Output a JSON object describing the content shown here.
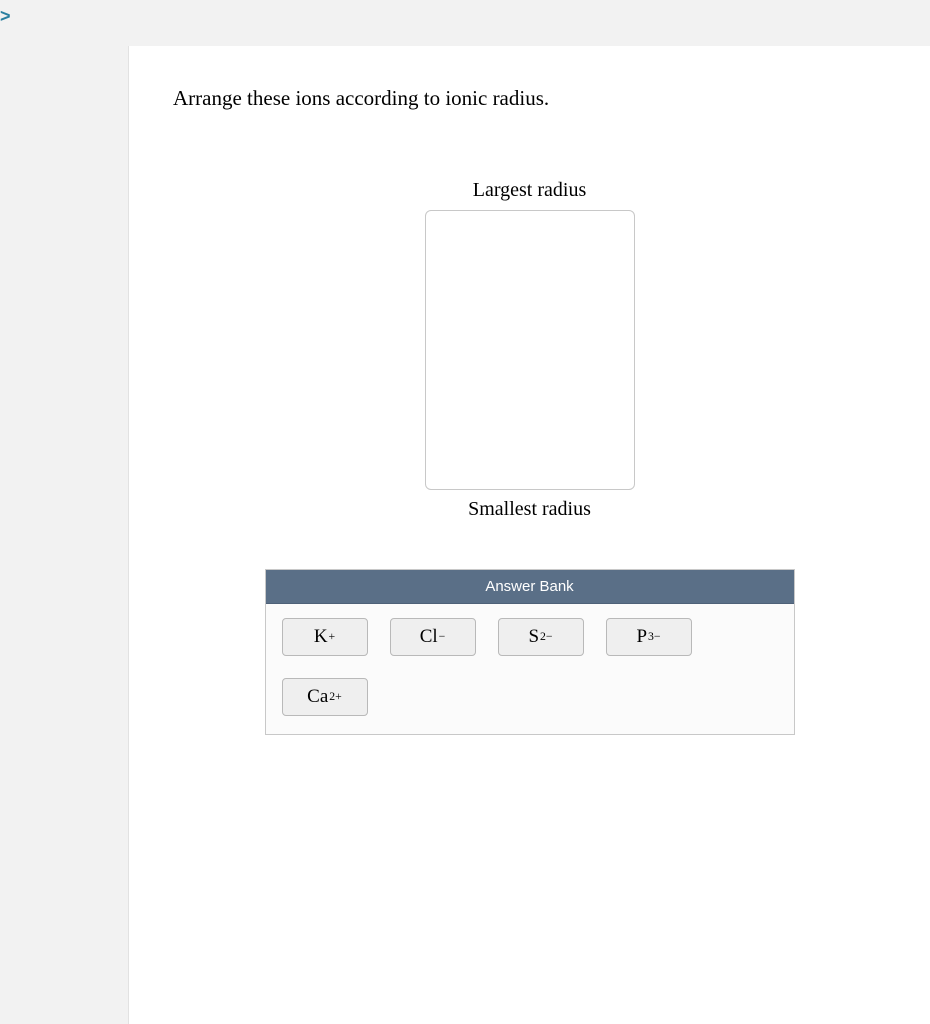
{
  "question": "Arrange these ions according to ionic radius.",
  "rank": {
    "top_label": "Largest radius",
    "bottom_label": "Smallest radius"
  },
  "answer_bank": {
    "title": "Answer Bank",
    "ions": [
      {
        "base": "K",
        "sup": "+"
      },
      {
        "base": "Cl",
        "sup": "−"
      },
      {
        "base": "S",
        "sup": "2−"
      },
      {
        "base": "P",
        "sup": "3−"
      },
      {
        "base": "Ca",
        "sup": "2+"
      }
    ]
  }
}
